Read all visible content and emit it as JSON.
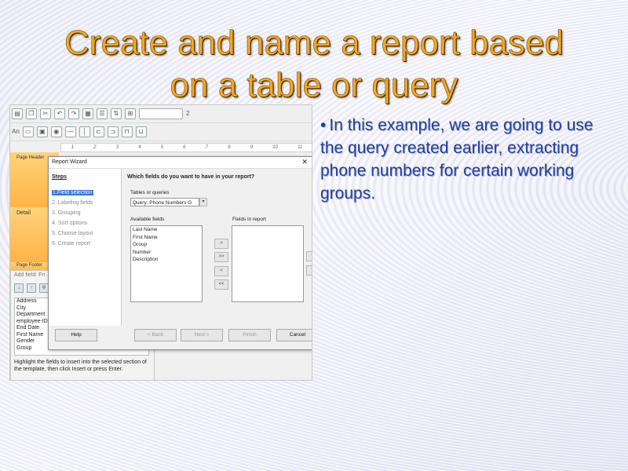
{
  "slide": {
    "title_line1": "Create and name a report based",
    "title_line2": "on a table or query",
    "bullet_marker": "•",
    "bullet": "In this example, we are going to use the query created earlier, extracting phone numbers for certain working groups."
  },
  "toolbar": {
    "font_size": "2",
    "abc_label": "An"
  },
  "report_sections": {
    "page_header": "Page Header",
    "detail": "Detail",
    "page_footer": "Page Footer"
  },
  "add_field_panel": {
    "title": "Add field: Fn",
    "fields": [
      "Address",
      "City",
      "Department",
      "employee-ID",
      "End Date",
      "First Name",
      "Gender",
      "Group"
    ],
    "hint": "Highlight the fields to insert into the selected section of the template, then click Insert or press Enter."
  },
  "dialog": {
    "title": "Report Wizard",
    "close": "✕",
    "steps_heading": "Steps",
    "steps": [
      "1.Field selection",
      "2. Labeling fields",
      "3. Grouping",
      "4. Sort options",
      "5. Choose layout",
      "6. Create report"
    ],
    "question": "Which fields do you want to have in your report?",
    "tables_label": "Tables or queries",
    "selected_query": "Query: Phone Numbers G",
    "available_label": "Available fields",
    "available_fields": [
      "Last Name",
      "First Name",
      "Group",
      "Number",
      "Description"
    ],
    "report_label": "Fields in report",
    "move_buttons": [
      ">",
      ">>",
      "<",
      "<<"
    ],
    "order_buttons": [
      "^",
      "v"
    ],
    "buttons": {
      "help": "Help",
      "back": "< Back",
      "next": "Next >",
      "finish": "Finish",
      "cancel": "Cancel"
    }
  }
}
